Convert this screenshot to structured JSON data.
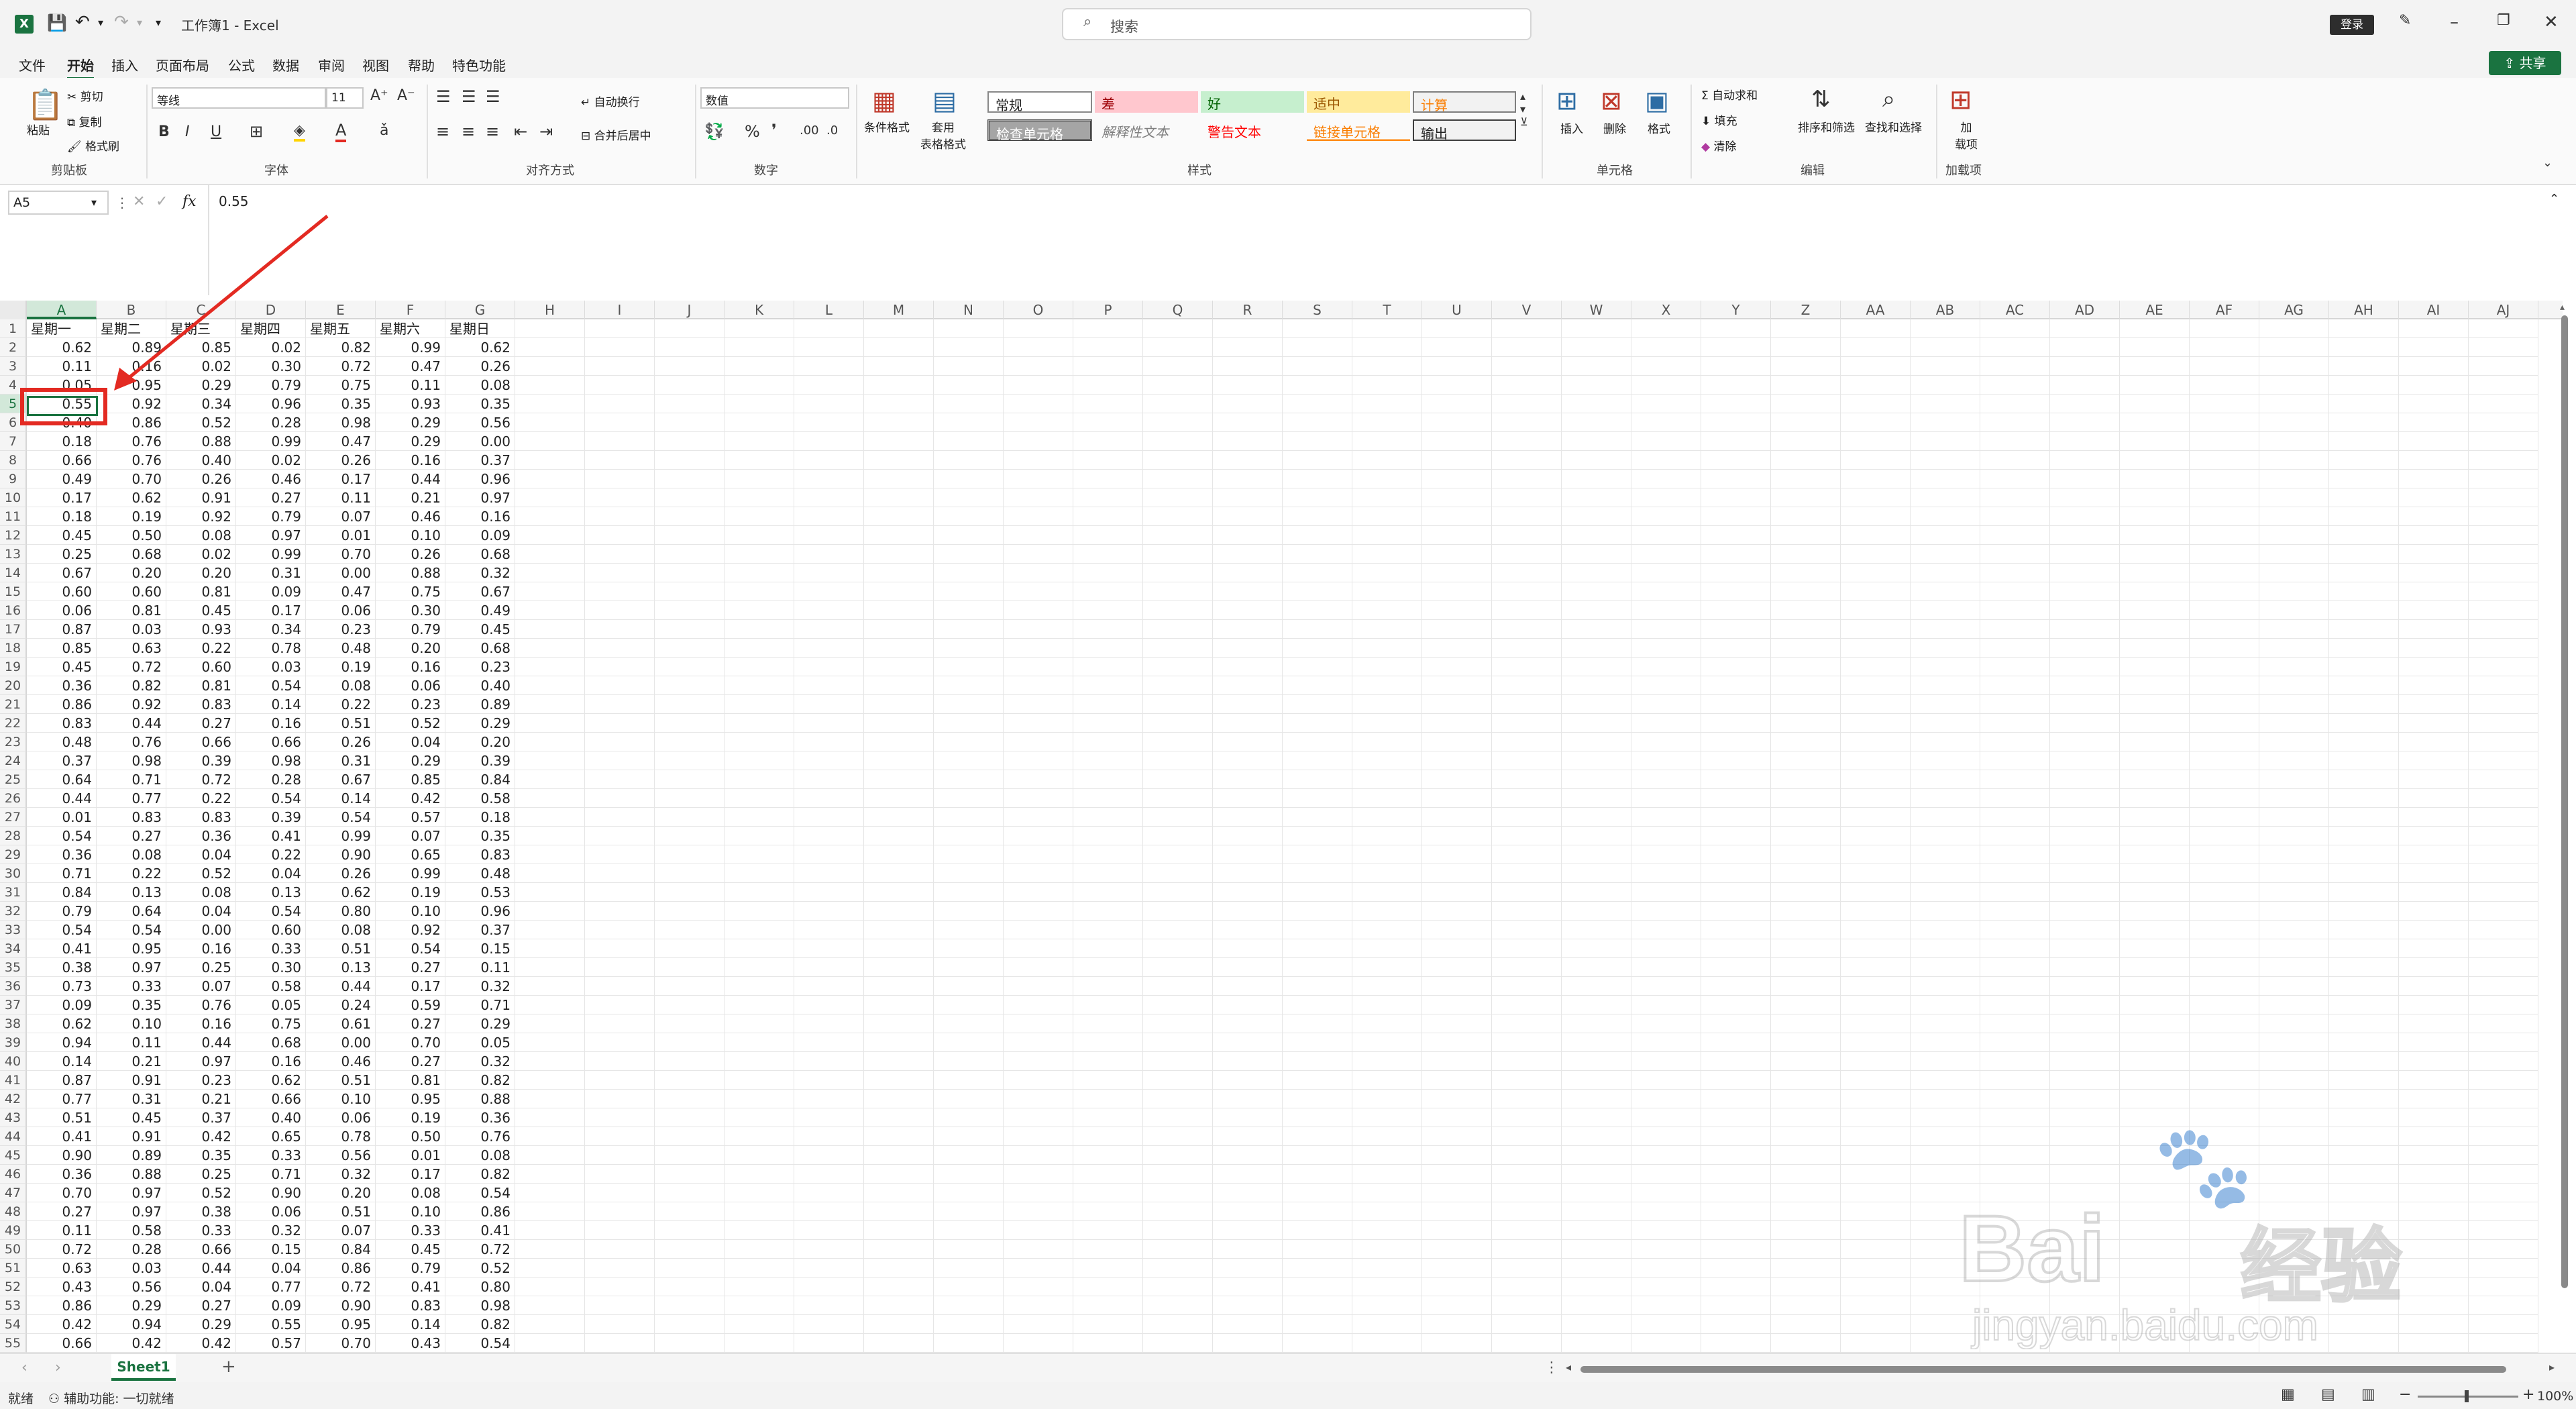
{
  "titlebar": {
    "title": "工作簿1  -  Excel",
    "search_placeholder": "搜索",
    "login_label": "登录"
  },
  "menu": {
    "items": [
      "文件",
      "开始",
      "插入",
      "页面布局",
      "公式",
      "数据",
      "审阅",
      "视图",
      "帮助",
      "特色功能"
    ],
    "active": "开始",
    "share_label": "共享"
  },
  "ribbon": {
    "clipboard": {
      "paste": "粘贴",
      "cut": "剪切",
      "copy": "复制",
      "format_painter": "格式刷",
      "group": "剪贴板"
    },
    "font": {
      "name": "等线",
      "size": "11",
      "group": "字体"
    },
    "align": {
      "wrap": "自动换行",
      "merge": "合并后居中",
      "group": "对齐方式"
    },
    "number": {
      "format": "数值",
      "group": "数字"
    },
    "styles": {
      "conditional": "条件格式",
      "table": "套用\n表格格式",
      "cells": [
        "常规",
        "差",
        "好",
        "适中",
        "计算",
        "检查单元格",
        "解释性文本",
        "警告文本",
        "链接单元格",
        "输出"
      ],
      "group": "样式"
    },
    "cells_group": {
      "insert": "插入",
      "delete": "删除",
      "format": "格式",
      "group": "单元格"
    },
    "edit": {
      "autosum": "自动求和",
      "fill": "填充",
      "clear": "清除",
      "sort": "排序和筛选",
      "find": "查找和选择",
      "group": "编辑"
    },
    "addins": {
      "label": "加\n载项",
      "group": "加载项"
    }
  },
  "formula_bar": {
    "name_box": "A5",
    "value": "0.55",
    "fx": "fx"
  },
  "columns": [
    "A",
    "B",
    "C",
    "D",
    "E",
    "F",
    "G",
    "H",
    "I",
    "J",
    "K",
    "L",
    "M",
    "N",
    "O",
    "P",
    "Q",
    "R",
    "S",
    "T",
    "U",
    "V",
    "W",
    "X",
    "Y",
    "Z",
    "AA",
    "AB",
    "AC",
    "AD",
    "AE",
    "AF",
    "AG",
    "AH",
    "AI",
    "AJ"
  ],
  "header_row": [
    "星期一",
    "星期二",
    "星期三",
    "星期四",
    "星期五",
    "星期六",
    "星期日"
  ],
  "table": [
    [
      "0.62",
      "0.89",
      "0.85",
      "0.02",
      "0.82",
      "0.99",
      "0.62"
    ],
    [
      "0.11",
      "0.16",
      "0.02",
      "0.30",
      "0.72",
      "0.47",
      "0.26"
    ],
    [
      "0.05",
      "0.95",
      "0.29",
      "0.79",
      "0.75",
      "0.11",
      "0.08"
    ],
    [
      "0.55",
      "0.92",
      "0.34",
      "0.96",
      "0.35",
      "0.93",
      "0.35"
    ],
    [
      "0.40",
      "0.86",
      "0.52",
      "0.28",
      "0.98",
      "0.29",
      "0.56"
    ],
    [
      "0.18",
      "0.76",
      "0.88",
      "0.99",
      "0.47",
      "0.29",
      "0.00"
    ],
    [
      "0.66",
      "0.76",
      "0.40",
      "0.02",
      "0.26",
      "0.16",
      "0.37"
    ],
    [
      "0.49",
      "0.70",
      "0.26",
      "0.46",
      "0.17",
      "0.44",
      "0.96"
    ],
    [
      "0.17",
      "0.62",
      "0.91",
      "0.27",
      "0.11",
      "0.21",
      "0.97"
    ],
    [
      "0.18",
      "0.19",
      "0.92",
      "0.79",
      "0.07",
      "0.46",
      "0.16"
    ],
    [
      "0.45",
      "0.50",
      "0.08",
      "0.97",
      "0.01",
      "0.10",
      "0.09"
    ],
    [
      "0.25",
      "0.68",
      "0.02",
      "0.99",
      "0.70",
      "0.26",
      "0.68"
    ],
    [
      "0.67",
      "0.20",
      "0.20",
      "0.31",
      "0.00",
      "0.88",
      "0.32"
    ],
    [
      "0.60",
      "0.60",
      "0.81",
      "0.09",
      "0.47",
      "0.75",
      "0.67"
    ],
    [
      "0.06",
      "0.81",
      "0.45",
      "0.17",
      "0.06",
      "0.30",
      "0.49"
    ],
    [
      "0.87",
      "0.03",
      "0.93",
      "0.34",
      "0.23",
      "0.79",
      "0.45"
    ],
    [
      "0.85",
      "0.63",
      "0.22",
      "0.78",
      "0.48",
      "0.20",
      "0.68"
    ],
    [
      "0.45",
      "0.72",
      "0.60",
      "0.03",
      "0.19",
      "0.16",
      "0.23"
    ],
    [
      "0.36",
      "0.82",
      "0.81",
      "0.54",
      "0.08",
      "0.06",
      "0.40"
    ],
    [
      "0.86",
      "0.92",
      "0.83",
      "0.14",
      "0.22",
      "0.23",
      "0.89"
    ],
    [
      "0.83",
      "0.44",
      "0.27",
      "0.16",
      "0.51",
      "0.52",
      "0.29"
    ],
    [
      "0.48",
      "0.76",
      "0.66",
      "0.66",
      "0.26",
      "0.04",
      "0.20"
    ],
    [
      "0.37",
      "0.98",
      "0.39",
      "0.98",
      "0.31",
      "0.29",
      "0.39"
    ],
    [
      "0.64",
      "0.71",
      "0.72",
      "0.28",
      "0.67",
      "0.85",
      "0.84"
    ],
    [
      "0.44",
      "0.77",
      "0.22",
      "0.54",
      "0.14",
      "0.42",
      "0.58"
    ],
    [
      "0.01",
      "0.83",
      "0.83",
      "0.39",
      "0.54",
      "0.57",
      "0.18"
    ],
    [
      "0.54",
      "0.27",
      "0.36",
      "0.41",
      "0.99",
      "0.07",
      "0.35"
    ],
    [
      "0.36",
      "0.08",
      "0.04",
      "0.22",
      "0.90",
      "0.65",
      "0.83"
    ],
    [
      "0.71",
      "0.22",
      "0.52",
      "0.04",
      "0.26",
      "0.99",
      "0.48"
    ],
    [
      "0.84",
      "0.13",
      "0.08",
      "0.13",
      "0.62",
      "0.19",
      "0.53"
    ],
    [
      "0.79",
      "0.64",
      "0.04",
      "0.54",
      "0.80",
      "0.10",
      "0.96"
    ],
    [
      "0.54",
      "0.54",
      "0.00",
      "0.60",
      "0.08",
      "0.92",
      "0.37"
    ],
    [
      "0.41",
      "0.95",
      "0.16",
      "0.33",
      "0.51",
      "0.54",
      "0.15"
    ],
    [
      "0.38",
      "0.97",
      "0.25",
      "0.30",
      "0.13",
      "0.27",
      "0.11"
    ],
    [
      "0.73",
      "0.33",
      "0.07",
      "0.58",
      "0.44",
      "0.17",
      "0.32"
    ],
    [
      "0.09",
      "0.35",
      "0.76",
      "0.05",
      "0.24",
      "0.59",
      "0.71"
    ],
    [
      "0.62",
      "0.10",
      "0.16",
      "0.75",
      "0.61",
      "0.27",
      "0.29"
    ],
    [
      "0.94",
      "0.11",
      "0.44",
      "0.68",
      "0.00",
      "0.70",
      "0.05"
    ],
    [
      "0.14",
      "0.21",
      "0.97",
      "0.16",
      "0.46",
      "0.27",
      "0.32"
    ],
    [
      "0.87",
      "0.91",
      "0.23",
      "0.62",
      "0.51",
      "0.81",
      "0.82"
    ],
    [
      "0.77",
      "0.31",
      "0.21",
      "0.66",
      "0.10",
      "0.95",
      "0.88"
    ],
    [
      "0.51",
      "0.45",
      "0.37",
      "0.40",
      "0.06",
      "0.19",
      "0.36"
    ],
    [
      "0.41",
      "0.91",
      "0.42",
      "0.65",
      "0.78",
      "0.50",
      "0.76"
    ],
    [
      "0.90",
      "0.89",
      "0.35",
      "0.33",
      "0.56",
      "0.01",
      "0.08"
    ],
    [
      "0.36",
      "0.88",
      "0.25",
      "0.71",
      "0.32",
      "0.17",
      "0.82"
    ],
    [
      "0.70",
      "0.97",
      "0.52",
      "0.90",
      "0.20",
      "0.08",
      "0.54"
    ],
    [
      "0.27",
      "0.97",
      "0.38",
      "0.06",
      "0.51",
      "0.10",
      "0.86"
    ],
    [
      "0.11",
      "0.58",
      "0.33",
      "0.32",
      "0.07",
      "0.33",
      "0.41"
    ],
    [
      "0.72",
      "0.28",
      "0.66",
      "0.15",
      "0.84",
      "0.45",
      "0.72"
    ],
    [
      "0.63",
      "0.03",
      "0.44",
      "0.04",
      "0.86",
      "0.79",
      "0.52"
    ],
    [
      "0.43",
      "0.56",
      "0.04",
      "0.77",
      "0.72",
      "0.41",
      "0.80"
    ],
    [
      "0.86",
      "0.29",
      "0.27",
      "0.09",
      "0.90",
      "0.83",
      "0.98"
    ],
    [
      "0.42",
      "0.94",
      "0.29",
      "0.55",
      "0.95",
      "0.14",
      "0.82"
    ],
    [
      "0.66",
      "0.42",
      "0.42",
      "0.57",
      "0.70",
      "0.43",
      "0.54"
    ]
  ],
  "selected": {
    "col": "A",
    "row": 5
  },
  "sheet": {
    "tab": "Sheet1",
    "add": "+"
  },
  "status": {
    "ready": "就绪",
    "accessibility": "辅助功能: 一切就绪",
    "zoom": "100%"
  },
  "watermark": {
    "brand": "Bai",
    "cn": "经验",
    "url": "jingyan.baidu.com"
  },
  "colors": {
    "accent": "#1a7340",
    "highlight": "#e32a22"
  }
}
